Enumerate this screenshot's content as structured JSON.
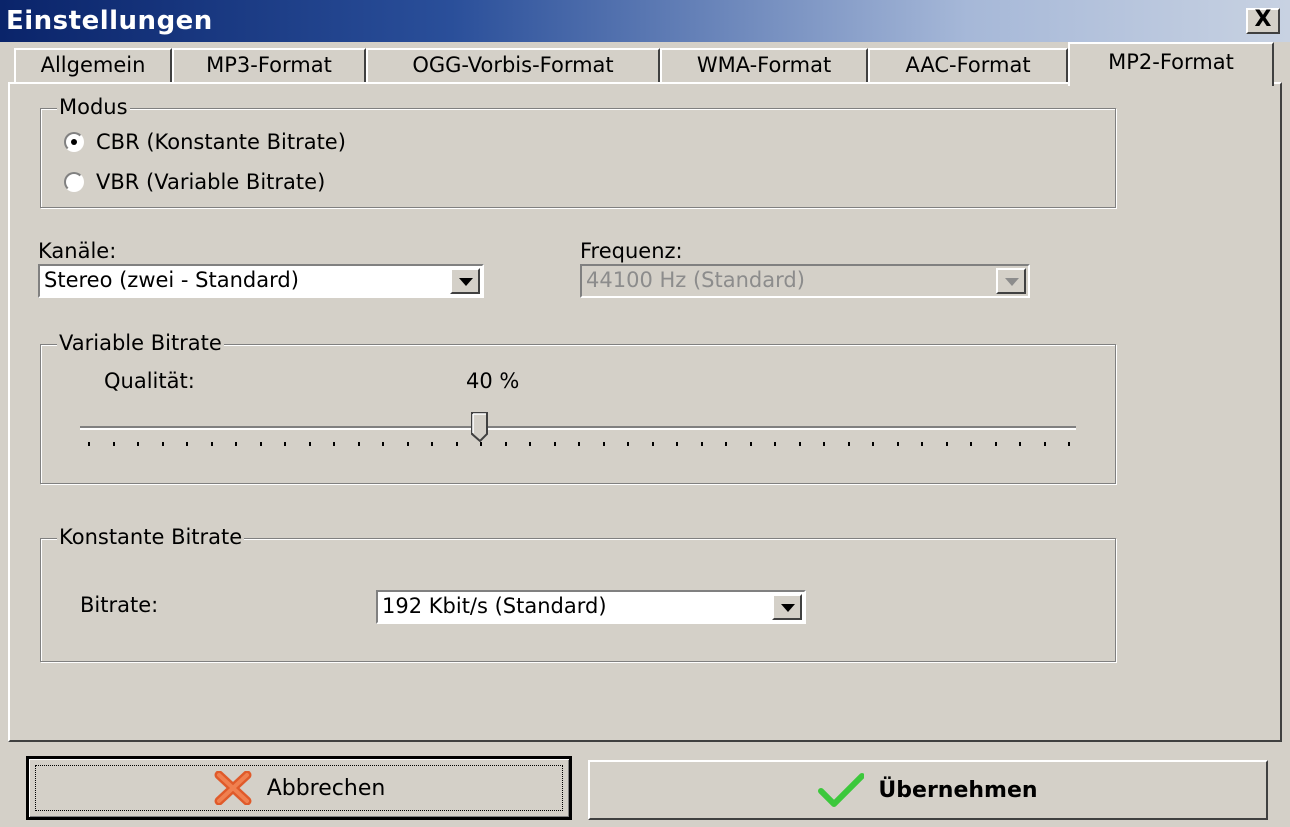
{
  "window": {
    "title": "Einstellungen",
    "close_label": "X"
  },
  "tabs": [
    {
      "label": "Allgemein"
    },
    {
      "label": "MP3-Format"
    },
    {
      "label": "OGG-Vorbis-Format"
    },
    {
      "label": "WMA-Format"
    },
    {
      "label": "AAC-Format"
    },
    {
      "label": "MP2-Format",
      "active": true
    }
  ],
  "modus": {
    "legend": "Modus",
    "options": [
      {
        "label": "CBR (Konstante Bitrate)",
        "checked": true
      },
      {
        "label": "VBR (Variable Bitrate)",
        "checked": false
      }
    ]
  },
  "channels": {
    "label": "Kanäle:",
    "value": "Stereo (zwei - Standard)"
  },
  "frequency": {
    "label": "Frequenz:",
    "value": "44100 Hz (Standard)",
    "enabled": false
  },
  "vbr": {
    "legend": "Variable Bitrate",
    "quality_label": "Qualität:",
    "quality_value": "40 %",
    "slider_fraction": 0.4,
    "tick_count": 41
  },
  "cbr": {
    "legend": "Konstante Bitrate",
    "bitrate_label": "Bitrate:",
    "bitrate_value": "192 Kbit/s (Standard)"
  },
  "buttons": {
    "cancel": "Abbrechen",
    "apply": "Übernehmen"
  },
  "icons": {
    "cancel": "red-x-icon",
    "apply": "green-check-icon"
  },
  "colors": {
    "titlebar": "#0a246a",
    "face": "#d4d0c8",
    "cancel_icon": "#e05a2a",
    "apply_icon": "#3cc83c"
  }
}
